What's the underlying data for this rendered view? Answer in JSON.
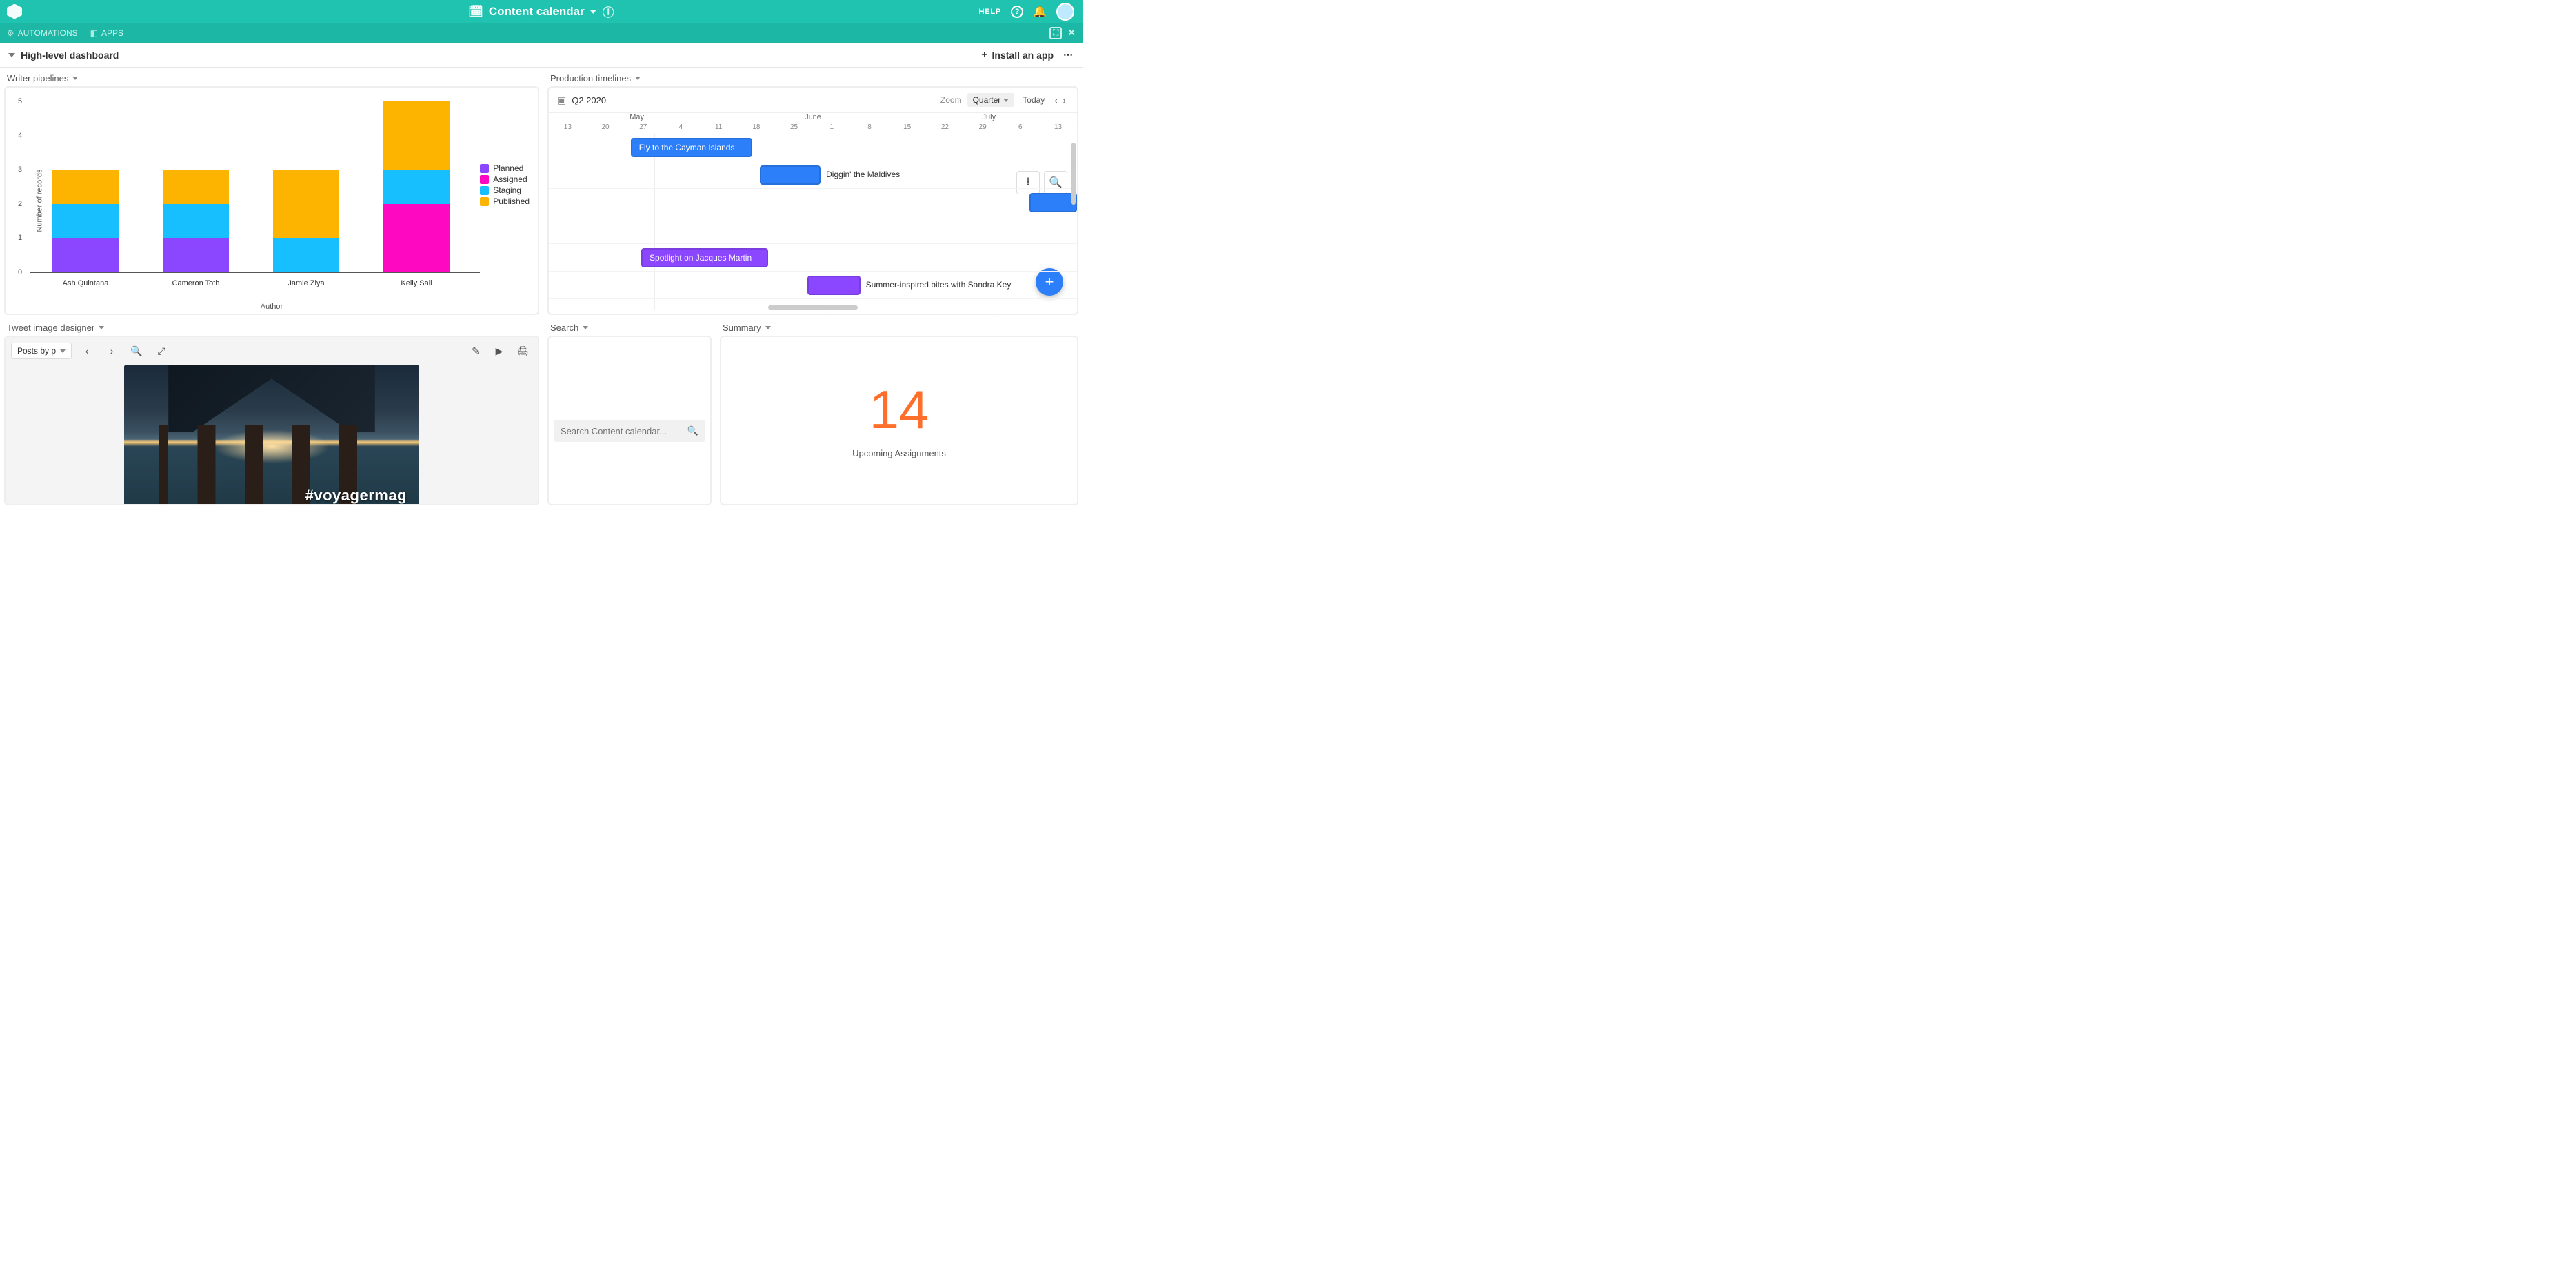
{
  "header": {
    "base_title": "Content calendar",
    "help_label": "HELP",
    "automations_label": "AUTOMATIONS",
    "apps_label": "APPS"
  },
  "dashboard_bar": {
    "title": "High-level dashboard",
    "install_label": "Install an app"
  },
  "panels": {
    "writer_pipelines": {
      "title": "Writer pipelines"
    },
    "production_timelines": {
      "title": "Production timelines"
    },
    "tweet_designer": {
      "title": "Tweet image designer"
    },
    "search": {
      "title": "Search"
    },
    "summary": {
      "title": "Summary"
    }
  },
  "chart_data": {
    "type": "bar",
    "stacked": true,
    "xlabel": "Author",
    "ylabel": "Number of records",
    "ylim": [
      0,
      5
    ],
    "y_ticks": [
      0,
      1,
      2,
      3,
      4,
      5
    ],
    "categories": [
      "Ash Quintana",
      "Cameron Toth",
      "Jamie Ziya",
      "Kelly Sall"
    ],
    "series": [
      {
        "name": "Planned",
        "color": "#8b46ff",
        "values": [
          1,
          1,
          0,
          0
        ]
      },
      {
        "name": "Assigned",
        "color": "#ff08c2",
        "values": [
          0,
          0,
          0,
          2
        ]
      },
      {
        "name": "Staging",
        "color": "#18bfff",
        "values": [
          1,
          1,
          1,
          1
        ]
      },
      {
        "name": "Published",
        "color": "#fcb400",
        "values": [
          1,
          1,
          2,
          2
        ]
      }
    ]
  },
  "timeline": {
    "label": "Q2 2020",
    "zoom_label": "Zoom",
    "scale_label": "Quarter",
    "today_label": "Today",
    "months": [
      "May",
      "June",
      "July"
    ],
    "days": [
      "13",
      "20",
      "27",
      "4",
      "11",
      "18",
      "25",
      "1",
      "8",
      "15",
      "22",
      "29",
      "6",
      "13"
    ],
    "events": [
      {
        "label": "Fly to the Cayman Islands",
        "color": "#2d7ff9",
        "row": 0,
        "left_pct": 15.5,
        "width_pct": 23,
        "text_inside": true
      },
      {
        "label": "Diggin' the Maldives",
        "color": "#2d7ff9",
        "row": 1,
        "left_pct": 40,
        "width_pct": 11.5,
        "text_inside": false
      },
      {
        "label": "",
        "color": "#2d7ff9",
        "row": 2,
        "left_pct": 91,
        "width_pct": 9,
        "text_inside": true
      },
      {
        "label": "Spotlight on Jacques Martin",
        "color": "#8b46ff",
        "row": 4,
        "left_pct": 17.5,
        "width_pct": 24,
        "text_inside": true
      },
      {
        "label": "Summer-inspired bites with Sandra Key",
        "color": "#8b46ff",
        "row": 5,
        "left_pct": 49,
        "width_pct": 10,
        "text_inside": false
      }
    ]
  },
  "tweet": {
    "select_label": "Posts by p",
    "hashtag": "#voyagermag"
  },
  "search": {
    "placeholder": "Search Content calendar..."
  },
  "summary": {
    "value": "14",
    "label": "Upcoming Assignments"
  }
}
